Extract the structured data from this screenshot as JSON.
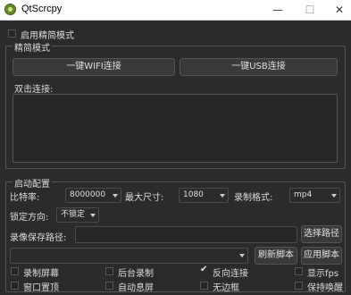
{
  "window": {
    "title": "QtScrcpy",
    "minimize": "—",
    "maximize": "☐",
    "close": "✕"
  },
  "simple_mode": {
    "label": "启用精简模式",
    "checked": false
  },
  "simple_group": {
    "title": "精简模式",
    "wifi_button": "一键WIFI连接",
    "usb_button": "一键USB连接",
    "double_click_label": "双击连接:"
  },
  "start_config": {
    "title": "启动配置",
    "bitrate_label": "比特率:",
    "bitrate_value": "8000000",
    "max_size_label": "最大尺寸:",
    "max_size_value": "1080",
    "record_format_label": "录制格式:",
    "record_format_value": "mp4",
    "lock_orientation_label": "锁定方向:",
    "lock_orientation_value": "不锁定",
    "record_path_label": "录像保存路径:",
    "record_path_value": "",
    "select_path_button": "选择路径",
    "script_value": "",
    "refresh_script_button": "刷新脚本",
    "apply_script_button": "应用脚本",
    "options": [
      {
        "label": "录制屏幕",
        "checked": false
      },
      {
        "label": "后台录制",
        "checked": false
      },
      {
        "label": "反向连接",
        "checked": true
      },
      {
        "label": "显示fps",
        "checked": false
      },
      {
        "label": "窗口置顶",
        "checked": false
      },
      {
        "label": "自动息屏",
        "checked": false
      },
      {
        "label": "无边框",
        "checked": false
      },
      {
        "label": "保持唤醒",
        "checked": false
      }
    ]
  }
}
